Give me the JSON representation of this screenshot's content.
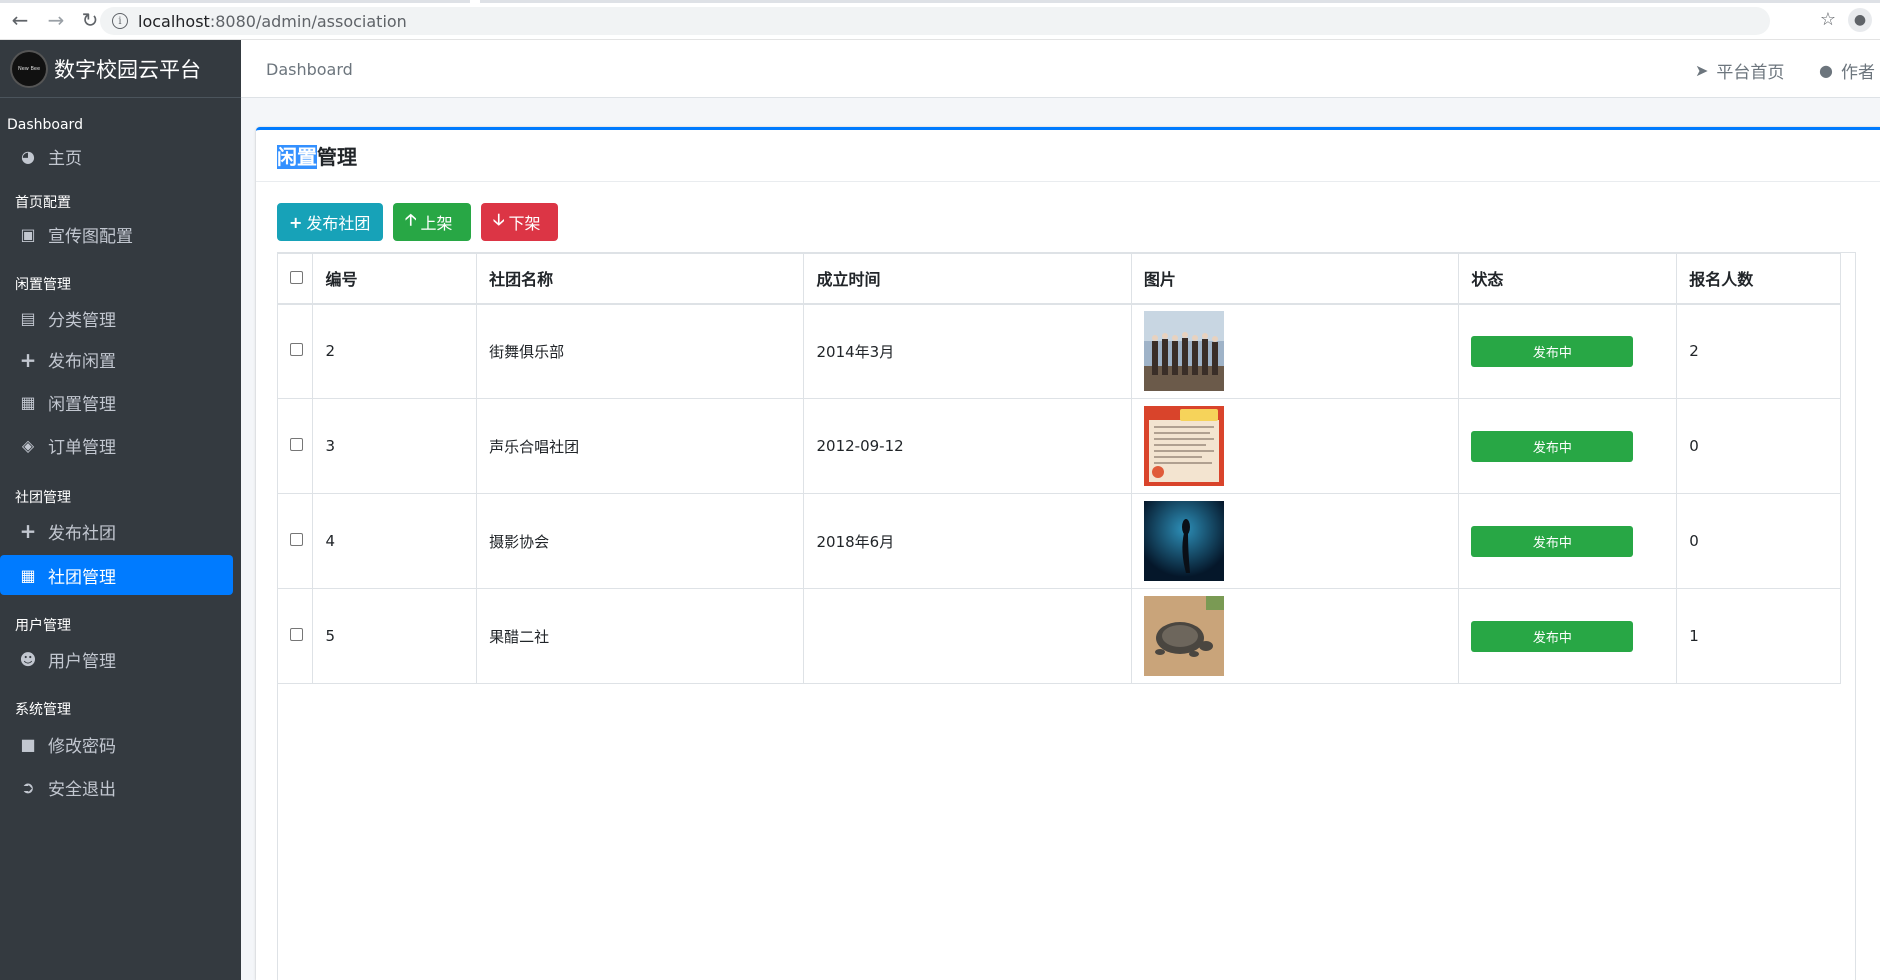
{
  "browser": {
    "url_host": "localhost",
    "url_rest": ":8080/admin/association"
  },
  "sidebar": {
    "brand": "数字校园云平台",
    "brand_logo_text": "New Bee",
    "sections": [
      {
        "header": "Dashboard",
        "items": [
          {
            "label": "主页",
            "icon": "dashboard-icon"
          }
        ]
      },
      {
        "header": "首页配置",
        "items": [
          {
            "label": "宣传图配置",
            "icon": "image-icon"
          }
        ]
      },
      {
        "header": "闲置管理",
        "items": [
          {
            "label": "分类管理",
            "icon": "list-icon"
          },
          {
            "label": "发布闲置",
            "icon": "plus-icon"
          },
          {
            "label": "闲置管理",
            "icon": "archive-icon"
          },
          {
            "label": "订单管理",
            "icon": "money-icon"
          }
        ]
      },
      {
        "header": "社团管理",
        "items": [
          {
            "label": "发布社团",
            "icon": "plus-icon"
          },
          {
            "label": "社团管理",
            "icon": "archive-icon",
            "active": true
          }
        ]
      },
      {
        "header": "用户管理",
        "items": [
          {
            "label": "用户管理",
            "icon": "users-icon"
          }
        ]
      },
      {
        "header": "系统管理",
        "items": [
          {
            "label": "修改密码",
            "icon": "lock-icon"
          },
          {
            "label": "安全退出",
            "icon": "sign-out-icon"
          }
        ]
      }
    ]
  },
  "topbar": {
    "breadcrumb": "Dashboard",
    "home_link": "平台首页",
    "author_link": "作者"
  },
  "card": {
    "title_selected": "闲置",
    "title_rest": "管理",
    "buttons": {
      "publish": "发布社团",
      "up": "上架",
      "down": "下架"
    }
  },
  "table": {
    "columns": [
      "编号",
      "社团名称",
      "成立时间",
      "图片",
      "状态",
      "报名人数"
    ],
    "rows": [
      {
        "id": "2",
        "name": "街舞俱乐部",
        "founded": "2014年3月",
        "status": "发布中",
        "count": "2",
        "image": "group-photo"
      },
      {
        "id": "3",
        "name": "声乐合唱社团",
        "founded": "2012-09-12",
        "status": "发布中",
        "count": "0",
        "image": "poster"
      },
      {
        "id": "4",
        "name": "摄影协会",
        "founded": "2018年6月",
        "status": "发布中",
        "count": "0",
        "image": "dark-blue-figure"
      },
      {
        "id": "5",
        "name": "果醋二社",
        "founded": "",
        "status": "发布中",
        "count": "1",
        "image": "turtle"
      }
    ]
  },
  "colors": {
    "primary": "#007bff",
    "info": "#17a2b8",
    "success": "#28a745",
    "danger": "#dc3545",
    "sidebar_bg": "#343a40"
  }
}
